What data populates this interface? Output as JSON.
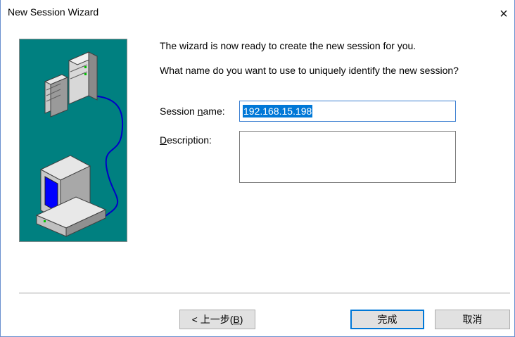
{
  "window": {
    "title": "New Session Wizard",
    "close_glyph": "×"
  },
  "message": {
    "line1": "The wizard is now ready to create the new session for you.",
    "line2": "What name do you want to use to uniquely identify the new session?"
  },
  "form": {
    "session_name_label_pre": "Session ",
    "session_name_label_accel": "n",
    "session_name_label_post": "ame:",
    "session_name_value": "192.168.15.198",
    "description_label_accel": "D",
    "description_label_post": "escription:",
    "description_value": ""
  },
  "buttons": {
    "back_pre": "< 上一步(",
    "back_accel": "B",
    "back_post": ")",
    "finish": "完成",
    "cancel": "取消"
  },
  "illustration": {
    "icon": "network-computers-icon",
    "background": "#008080",
    "screen_color": "#0000ff",
    "cable_color": "#0000c8"
  }
}
